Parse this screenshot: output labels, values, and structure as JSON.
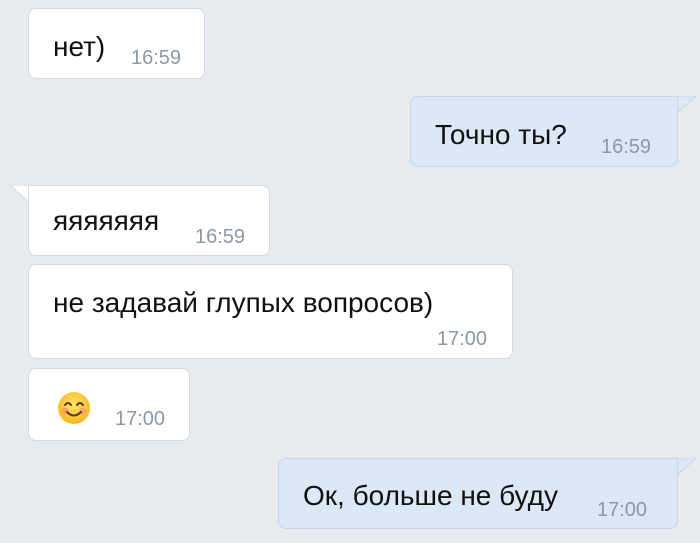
{
  "messages": [
    {
      "direction": "in",
      "text": "нет)",
      "time": "16:59"
    },
    {
      "direction": "out",
      "text": "Точно ты?",
      "time": "16:59"
    },
    {
      "direction": "in",
      "text": "яяяяяяя",
      "time": "16:59"
    },
    {
      "direction": "in",
      "text": "не задавай глупых вопросов)",
      "time": "17:00"
    },
    {
      "direction": "in",
      "emoji": "smiling-face-emoji",
      "time": "17:00"
    },
    {
      "direction": "out",
      "text": "Ок, больше не буду",
      "time": "17:00"
    }
  ],
  "colors": {
    "background": "#e7ebf0",
    "incoming_bubble": "#ffffff",
    "outgoing_bubble": "#dce8f6",
    "time_text": "#8a98a8"
  }
}
